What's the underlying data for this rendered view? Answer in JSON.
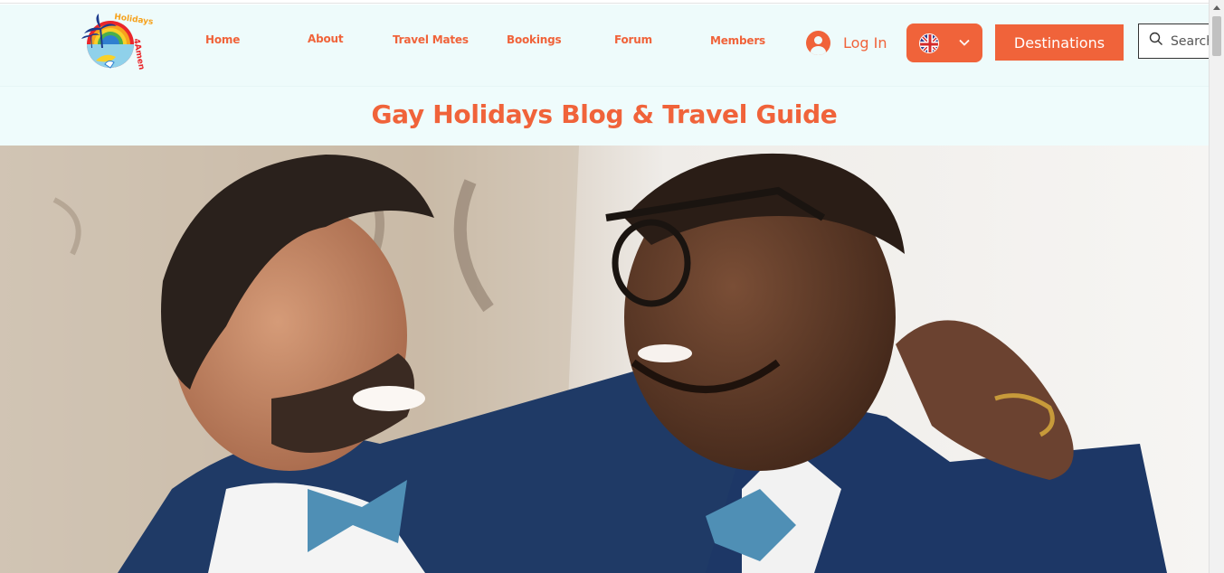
{
  "brand": {
    "logo_text": "Holidays4Amen",
    "colors": {
      "accent": "#f0633a",
      "header_bg": "#eefbfb"
    }
  },
  "nav": {
    "items": [
      {
        "label": "Home"
      },
      {
        "label": "About"
      },
      {
        "label": "Travel Mates"
      },
      {
        "label": "Bookings"
      },
      {
        "label": "Forum"
      },
      {
        "label": "Members"
      }
    ]
  },
  "login": {
    "label": "Log In",
    "icon": "user-avatar-icon"
  },
  "language": {
    "selected": "English",
    "icon": "uk-flag-icon"
  },
  "destinations_button": {
    "label": "Destinations"
  },
  "search": {
    "placeholder": "Search...",
    "icon": "search-icon"
  },
  "page": {
    "title": "Gay Holidays Blog & Travel Guide"
  },
  "hero": {
    "image": "two-smiling-men-in-suits-photo"
  }
}
